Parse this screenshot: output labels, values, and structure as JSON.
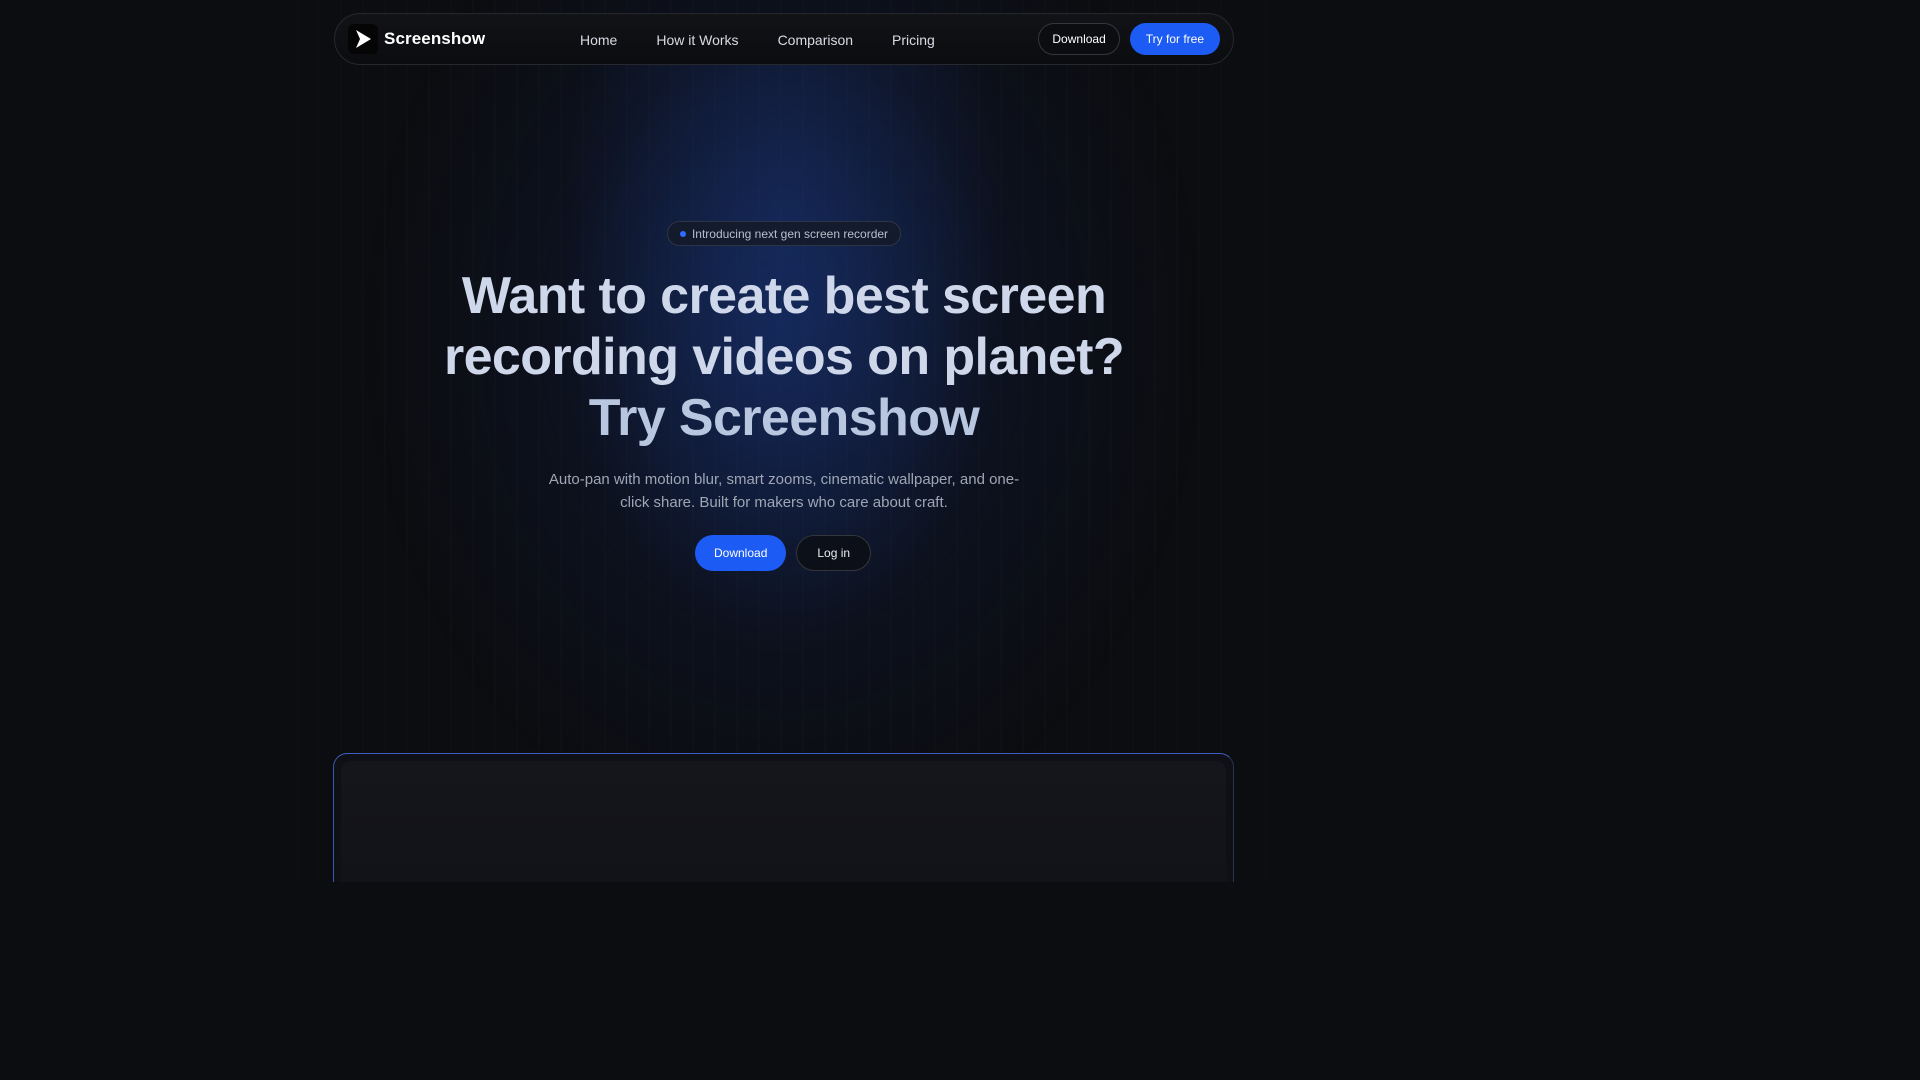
{
  "nav": {
    "brand_name": "Screenshow",
    "links": [
      "Home",
      "How it Works",
      "Comparison",
      "Pricing"
    ],
    "download_label": "Download",
    "try_label": "Try for free"
  },
  "hero": {
    "badge_text": "Introducing next gen screen recorder",
    "headline_lines": [
      "Want to create best screen",
      "recording videos on planet?",
      "Try Screenshow"
    ],
    "subtext_lines": [
      "Auto-pan with motion blur, smart zooms, cinematic wallpaper, and one-",
      "click share. Built for makers who care about craft."
    ],
    "primary_cta": "Download",
    "secondary_cta": "Log in"
  },
  "icons": {
    "logo": "play-icon"
  },
  "colors": {
    "background": "#0c0d10",
    "accent": "#1c5cf5",
    "badge_dot": "#2f6bff"
  }
}
